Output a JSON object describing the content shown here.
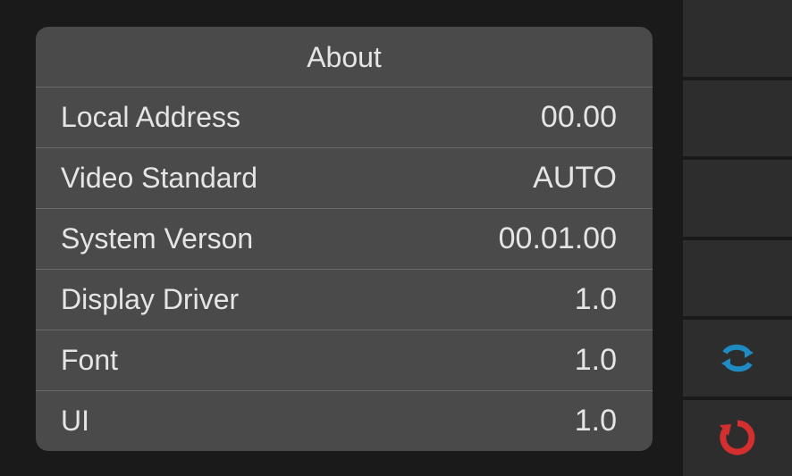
{
  "panel": {
    "title": "About",
    "rows": [
      {
        "label": "Local Address",
        "value": "00.00"
      },
      {
        "label": "Video Standard",
        "value": "AUTO"
      },
      {
        "label": "System Verson",
        "value": "00.01.00"
      },
      {
        "label": "Display Driver",
        "value": "1.0"
      },
      {
        "label": "Font",
        "value": "1.0"
      },
      {
        "label": "UI",
        "value": "1.0"
      }
    ]
  },
  "sidebar": {
    "refresh_icon": "refresh-icon",
    "reset_icon": "reset-icon"
  }
}
